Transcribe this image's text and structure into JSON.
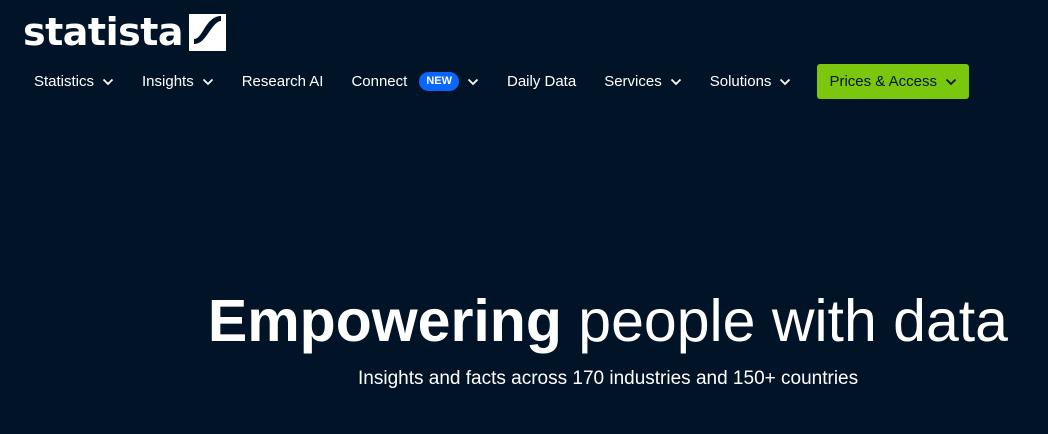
{
  "brand": {
    "name": "statista",
    "logo_icon": "statista-logo-mark"
  },
  "nav": {
    "items": [
      {
        "label": "Statistics",
        "has_dropdown": true
      },
      {
        "label": "Insights",
        "has_dropdown": true
      },
      {
        "label": "Research AI",
        "has_dropdown": false
      },
      {
        "label": "Connect",
        "badge": "NEW",
        "has_dropdown": true
      },
      {
        "label": "Daily Data",
        "has_dropdown": false
      },
      {
        "label": "Services",
        "has_dropdown": true
      },
      {
        "label": "Solutions",
        "has_dropdown": true
      }
    ],
    "cta": {
      "label": "Prices & Access",
      "has_dropdown": true
    }
  },
  "hero": {
    "title_strong": "Empowering",
    "title_rest": "people with data",
    "subtitle": "Insights and facts across 170 industries and 150+ countries"
  },
  "colors": {
    "background": "#001327",
    "cta_background": "#7bc70d",
    "badge_background": "#0a66ff",
    "text": "#ffffff"
  }
}
